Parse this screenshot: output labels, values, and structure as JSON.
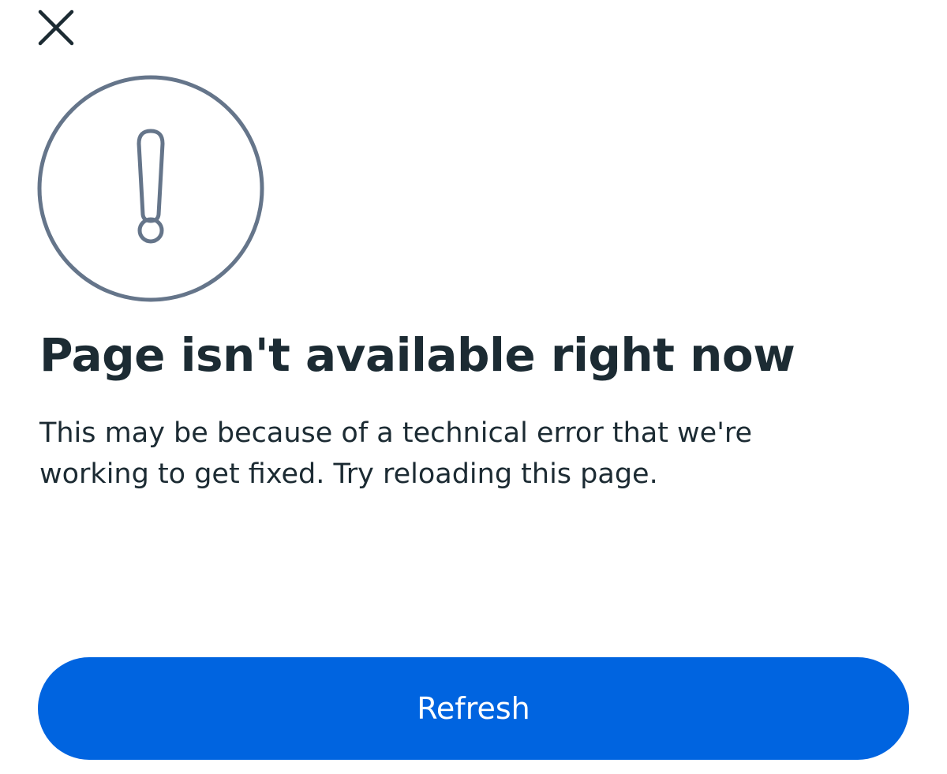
{
  "dialog": {
    "title": "Page isn't available right now",
    "message": "This may be because of a technical error that we're working to get fixed. Try reloading this page.",
    "refresh_label": "Refresh"
  },
  "icons": {
    "close": "close-icon",
    "alert": "exclamation-circle-icon"
  },
  "colors": {
    "button_bg": "#0064e0",
    "button_text": "#ffffff",
    "text": "#1c2b33",
    "icon_stroke": "#65758a",
    "background": "#ffffff"
  }
}
